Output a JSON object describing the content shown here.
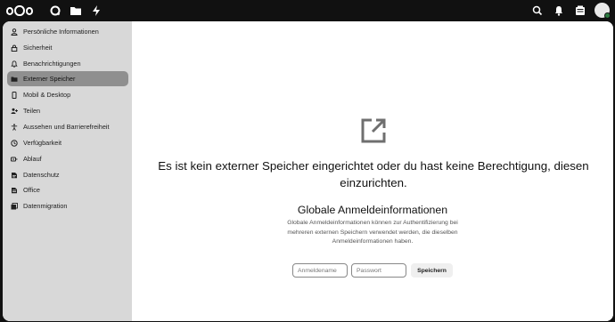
{
  "header": {
    "app_icons": [
      "dashboard-icon",
      "files-icon",
      "activity-icon"
    ],
    "right_icons": [
      "search-icon",
      "notifications-icon",
      "contacts-icon"
    ]
  },
  "sidebar": {
    "items": [
      {
        "label": "Persönliche Informationen",
        "icon": "user-icon",
        "active": false
      },
      {
        "label": "Sicherheit",
        "icon": "lock-icon",
        "active": false
      },
      {
        "label": "Benachrichtigungen",
        "icon": "bell-icon",
        "active": false
      },
      {
        "label": "Externer Speicher",
        "icon": "folder-icon",
        "active": true
      },
      {
        "label": "Mobil & Desktop",
        "icon": "phone-icon",
        "active": false
      },
      {
        "label": "Teilen",
        "icon": "share-icon",
        "active": false
      },
      {
        "label": "Aussehen und Barrierefreiheit",
        "icon": "accessibility-icon",
        "active": false
      },
      {
        "label": "Verfügbarkeit",
        "icon": "clock-icon",
        "active": false
      },
      {
        "label": "Ablauf",
        "icon": "flow-icon",
        "active": false
      },
      {
        "label": "Datenschutz",
        "icon": "privacy-icon",
        "active": false
      },
      {
        "label": "Office",
        "icon": "office-icon",
        "active": false
      },
      {
        "label": "Datenmigration",
        "icon": "migration-icon",
        "active": false
      }
    ]
  },
  "main": {
    "empty_icon": "open-in-new-icon",
    "empty_title": "Es ist kein externer Speicher eingerichtet oder du hast keine Berechtigung, diesen einzurichten.",
    "global_title": "Globale Anmeldeinformationen",
    "global_description": "Globale Anmeldeinformationen können zur Authentifizierung bei mehreren externen Speichern verwendet werden, die dieselben Anmeldeinformationen haben.",
    "login_placeholder": "Anmeldename",
    "password_placeholder": "Passwort",
    "save_label": "Speichern"
  },
  "colors": {
    "header_bg": "#111111",
    "sidebar_bg": "#d8d8d8",
    "active_item_bg": "#8f8f8f",
    "status_online": "#2d7b41"
  }
}
